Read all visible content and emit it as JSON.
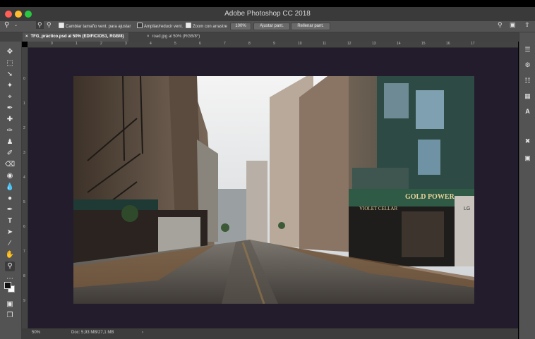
{
  "window": {
    "title": "Adobe Photoshop CC 2018"
  },
  "options": {
    "zoom_icon": "zoom-icon",
    "resize_windows": "Cambiar tamaño vent. para ajustar",
    "zoom_all": "Ampliar/reducir vent.",
    "scrubby_zoom": "Zoom con arrastre",
    "zoom_level": "100%",
    "fit_screen": "Ajustar pant.",
    "fill_screen": "Rellenar pant."
  },
  "tabs": [
    {
      "label": "TFG_práctico.psd al 50% (EDIFICIOS1, RGB/8)",
      "active": true
    },
    {
      "label": "road.jpg al 50% (RGB/8*)",
      "active": false
    }
  ],
  "rulers": {
    "horizontal": [
      "0",
      "1",
      "2",
      "3",
      "4",
      "5",
      "6",
      "7",
      "8",
      "9",
      "10",
      "11",
      "12",
      "13",
      "14",
      "15",
      "16",
      "17"
    ],
    "vertical": [
      "0",
      "1",
      "2",
      "3",
      "4",
      "5",
      "6",
      "7",
      "8",
      "9"
    ]
  },
  "photo": {
    "left_sign": "",
    "right_sign_1": "GOLD POWER",
    "right_sign_2": "VIOLET CELLAR",
    "right_sign_3": "LG"
  },
  "status": {
    "zoom": "50%",
    "doc": "Doc: 5,93 MB/27,1 MB"
  },
  "colors": {
    "canvas_bg": "#231c2c",
    "ui_dark": "#535353",
    "close": "#ff5f57",
    "minimize": "#febc2e",
    "maximize": "#28c840"
  }
}
